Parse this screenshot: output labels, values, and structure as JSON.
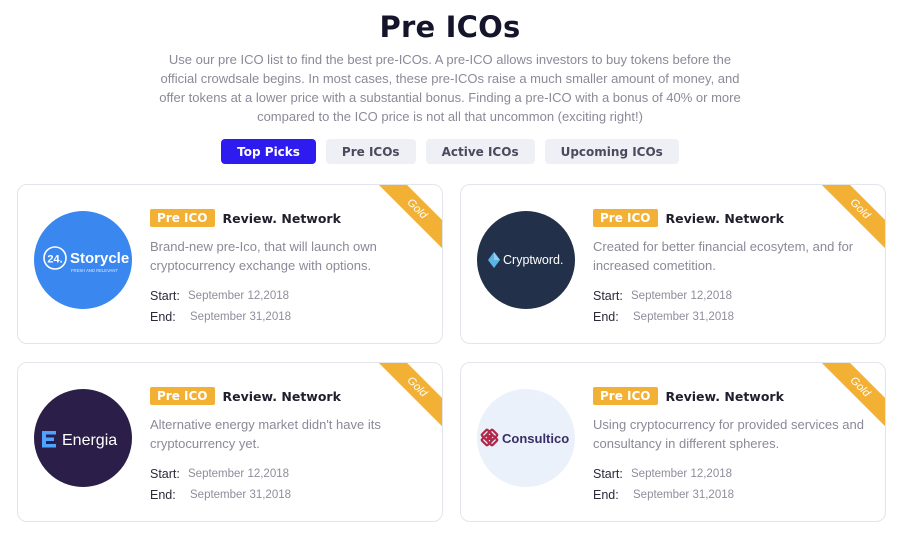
{
  "page": {
    "title": "Pre ICOs",
    "intro": "Use our pre ICO list to find the best pre-ICOs. A pre-ICO allows investors to buy tokens before the official crowdsale begins. In most cases, these pre-ICOs raise a much smaller amount of money, and offer tokens at a lower price with a substantial bonus. Finding a pre-ICO with a bonus of 40% or more compared to the ICO price is not all that uncommon (exciting right!)"
  },
  "tabs": [
    {
      "label": "Top Picks",
      "active": true
    },
    {
      "label": "Pre ICOs",
      "active": false
    },
    {
      "label": "Active ICOs",
      "active": false
    },
    {
      "label": "Upcoming ICOs",
      "active": false
    }
  ],
  "cards": [
    {
      "logo_text": "Storycle",
      "logo_prefix": "24.",
      "logo_tagline": "FRESH AND RELEVANT",
      "logo_bg": "#3b87f0",
      "ribbon": "Gold",
      "badge": "Pre ICO",
      "site": "Review. Network",
      "desc": "Brand-new pre-Ico, that will launch own cryptocurrency exchange with options.",
      "start_label": "Start:",
      "start": "September 12,2018",
      "end_label": "End:",
      "end": "September 31,2018"
    },
    {
      "logo_text": "Cryptword.",
      "logo_bg": "#22304a",
      "ribbon": "Gold",
      "badge": "Pre ICO",
      "site": "Review. Network",
      "desc": "Created for better financial ecosytem, and for increased cometition.",
      "start_label": "Start:",
      "start": "September 12,2018",
      "end_label": "End:",
      "end": "September 31,2018"
    },
    {
      "logo_text": "Energia",
      "logo_bg": "#2b1f4a",
      "ribbon": "Gold",
      "badge": "Pre ICO",
      "site": "Review. Network",
      "desc": "Alternative energy market didn't have its cryptocurrency yet.",
      "start_label": "Start:",
      "start": "September 12,2018",
      "end_label": "End:",
      "end": "September 31,2018"
    },
    {
      "logo_text": "Consultico",
      "logo_bg": "#eaf1fb",
      "ribbon": "Gold",
      "badge": "Pre ICO",
      "site": "Review. Network",
      "desc": "Using cryptocurrency for provided services and consultancy in different spheres.",
      "start_label": "Start:",
      "start": "September 12,2018",
      "end_label": "End:",
      "end": "September 31,2018"
    }
  ],
  "colors": {
    "accent": "#2d1bf0",
    "gold": "#f2b134"
  }
}
